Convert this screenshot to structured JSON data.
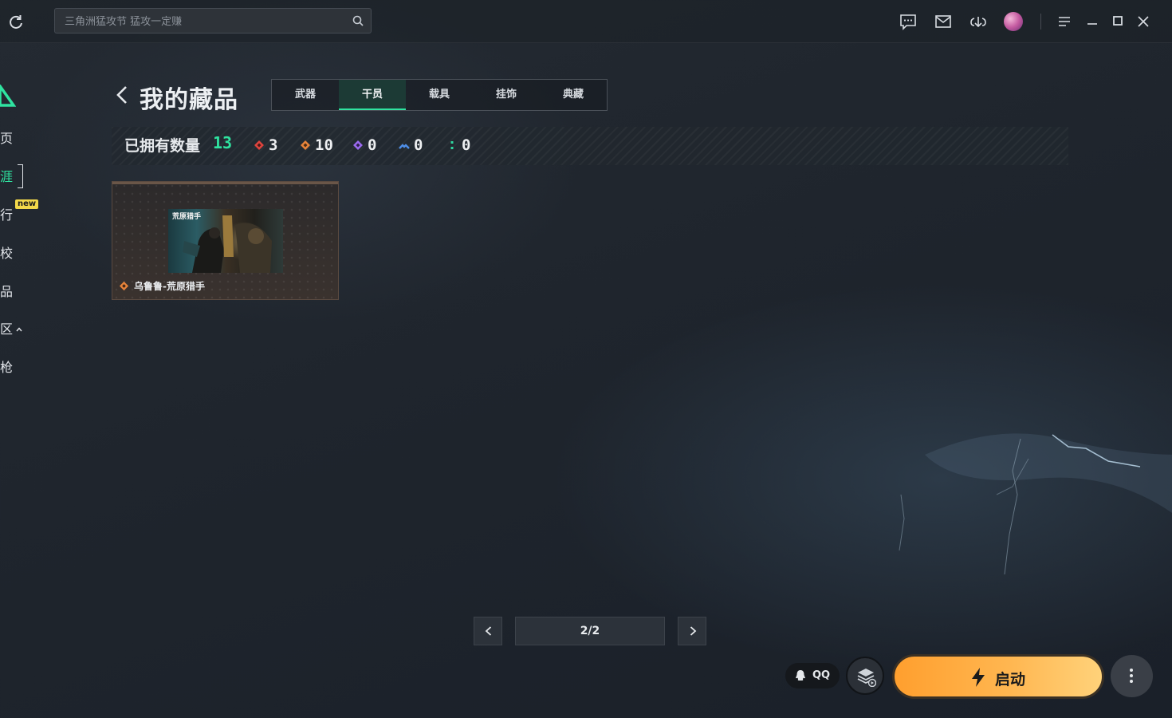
{
  "topbar": {
    "search_placeholder": "三角洲猛攻节 猛攻一定赚",
    "icons": [
      "refresh-icon",
      "search-icon",
      "chat-icon",
      "mail-icon",
      "download-icon",
      "avatar",
      "menu-icon",
      "minimize-icon",
      "maximize-icon",
      "close-icon"
    ]
  },
  "sidebar": {
    "items": [
      {
        "label": "页"
      },
      {
        "label": "涯",
        "active": true
      },
      {
        "label": "行",
        "badge": "new"
      },
      {
        "label": "校"
      },
      {
        "label": "品"
      },
      {
        "label": "区"
      },
      {
        "label": "枪"
      }
    ]
  },
  "header": {
    "title": "我的藏品",
    "tabs": [
      {
        "label": "武器"
      },
      {
        "label": "干员",
        "active": true
      },
      {
        "label": "载具"
      },
      {
        "label": "挂饰"
      },
      {
        "label": "典藏"
      }
    ]
  },
  "counts": {
    "label": "已拥有数量",
    "total": "13",
    "by_rarity": [
      {
        "value": "3",
        "color": "#e0443e"
      },
      {
        "value": "10",
        "color": "#e8843a"
      },
      {
        "value": "0",
        "color": "#9b6af0"
      },
      {
        "value": "0",
        "color": "#4e8ee8"
      },
      {
        "value": "0",
        "color": "#2fd7a0"
      }
    ]
  },
  "items": [
    {
      "name": "乌鲁鲁-荒原猎手",
      "image_label": "荒原猎手",
      "rarity_color": "#e8843a"
    }
  ],
  "pagination": {
    "label": "2/2"
  },
  "bottom": {
    "qq_label": "QQ",
    "launch_label": "启动"
  },
  "colors": {
    "accent": "#2fe3a0",
    "launch": "#ffb04a"
  }
}
